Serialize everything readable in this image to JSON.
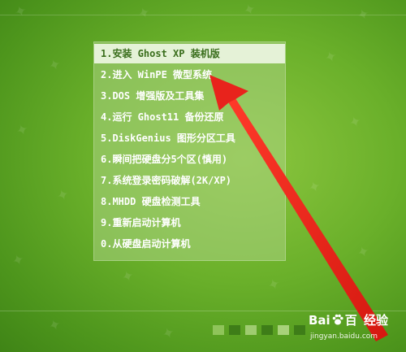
{
  "menu": {
    "items": [
      {
        "label": "1.安装 Ghost XP 装机版",
        "selected": true
      },
      {
        "label": "2.进入 WinPE 微型系统",
        "selected": false
      },
      {
        "label": "3.DOS 增强版及工具集",
        "selected": false
      },
      {
        "label": "4.运行 Ghost11 备份还原",
        "selected": false
      },
      {
        "label": "5.DiskGenius 图形分区工具",
        "selected": false
      },
      {
        "label": "6.瞬间把硬盘分5个区(慎用)",
        "selected": false
      },
      {
        "label": "7.系统登录密码破解(2K/XP)",
        "selected": false
      },
      {
        "label": "8.MHDD 硬盘检测工具",
        "selected": false
      },
      {
        "label": "9.重新启动计算机",
        "selected": false
      },
      {
        "label": "0.从硬盘启动计算机",
        "selected": false
      }
    ]
  },
  "watermark": {
    "brand_left": "Bai",
    "brand_right": "百",
    "product": "经验",
    "url": "jingyan.baidu.com"
  },
  "colors": {
    "selected_bg": "#e5f2d7",
    "selected_text": "#3a6e1c",
    "menu_text": "#ffffff",
    "arrow": "#e8231c",
    "blocks": [
      "#8fc45a",
      "#3e7d18",
      "#9fcc70",
      "#3e7d18",
      "#a8d27a",
      "#3e7d18"
    ]
  },
  "icons": {
    "arrow": "red-pointer-arrow-icon",
    "paw": "baidu-paw-icon"
  }
}
